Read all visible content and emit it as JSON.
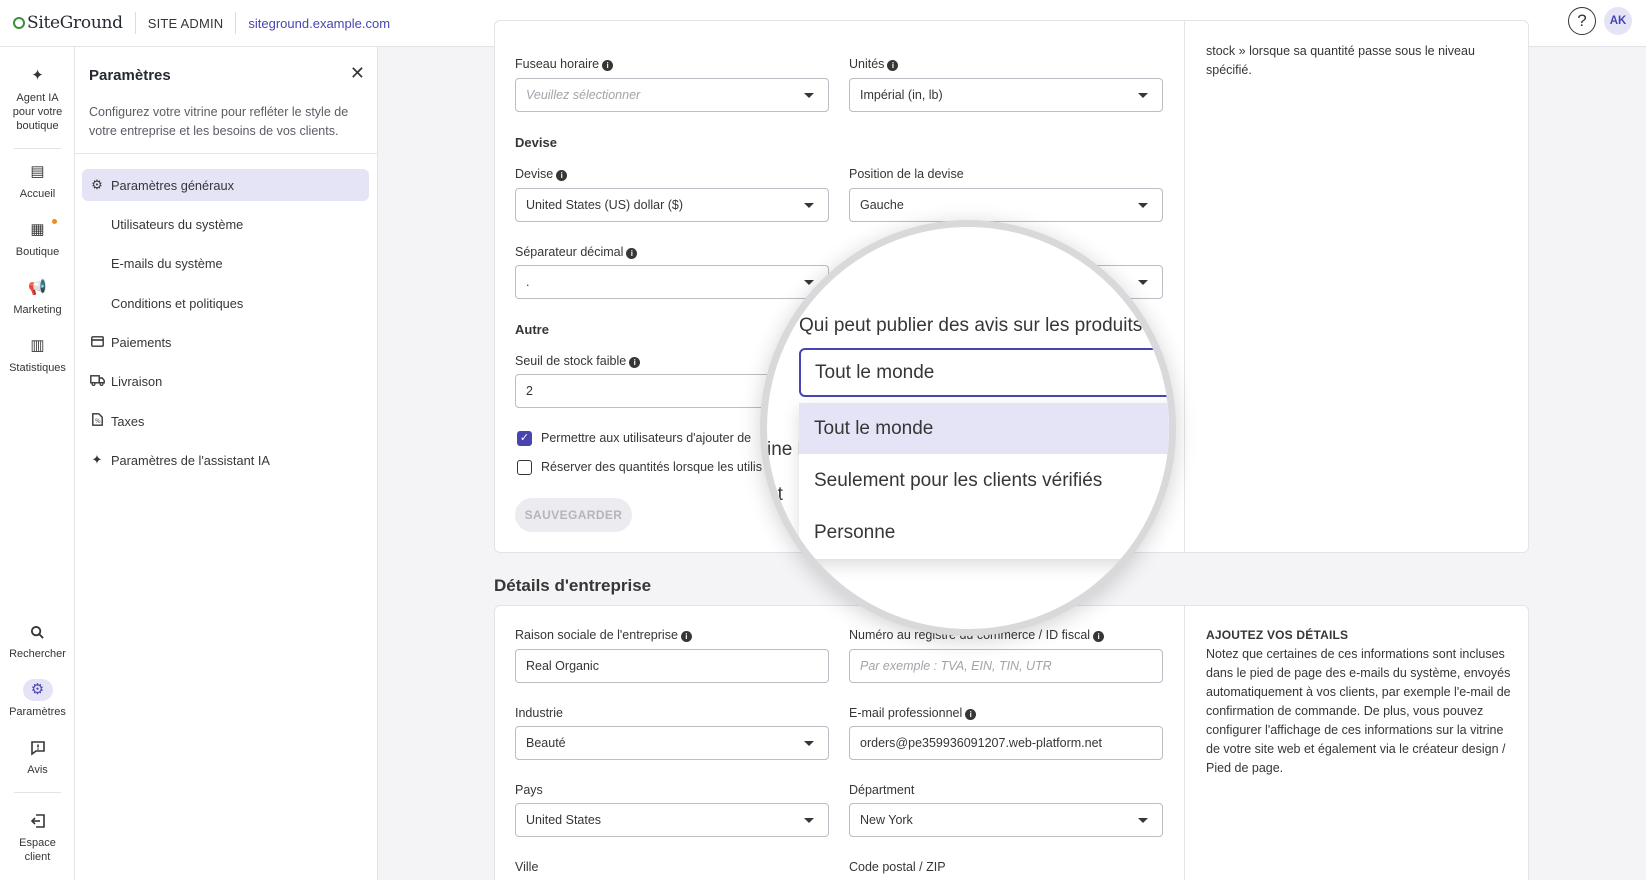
{
  "topbar": {
    "logo_text": "SiteGround",
    "site_admin": "SITE ADMIN",
    "domain": "siteground.example.com",
    "help_glyph": "?",
    "avatar_initials": "AK"
  },
  "rail": {
    "items": [
      {
        "label": "Agent IA pour votre boutique",
        "icon": "sparkle-icon"
      },
      {
        "label": "Accueil",
        "icon": "dashboard-icon"
      },
      {
        "label": "Boutique",
        "icon": "store-icon"
      },
      {
        "label": "Marketing",
        "icon": "megaphone-icon"
      },
      {
        "label": "Statistiques",
        "icon": "chart-icon"
      },
      {
        "label": "Rechercher",
        "icon": "search-icon"
      },
      {
        "label": "Paramètres",
        "icon": "gear-icon"
      },
      {
        "label": "Avis",
        "icon": "review-icon"
      },
      {
        "label": "Espace client",
        "icon": "exit-icon"
      }
    ]
  },
  "panel": {
    "title": "Paramètres",
    "description": "Configurez votre vitrine pour refléter le style de votre entreprise et les besoins de vos clients.",
    "nav": [
      {
        "label": "Paramètres généraux"
      },
      {
        "label": "Utilisateurs du système"
      },
      {
        "label": "E-mails du système"
      },
      {
        "label": "Conditions et politiques"
      },
      {
        "label": "Paiements"
      },
      {
        "label": "Livraison"
      },
      {
        "label": "Taxes"
      },
      {
        "label": "Paramètres de l'assistant IA"
      }
    ]
  },
  "general": {
    "timezone_label": "Fuseau horaire",
    "timezone_placeholder": "Veuillez sélectionner",
    "units_label": "Unités",
    "units_value": "Impérial (in, lb)",
    "currency_section": "Devise",
    "currency_label": "Devise",
    "currency_value": "United States (US) dollar ($)",
    "currency_position_label": "Position de la devise",
    "currency_position_value": "Gauche",
    "decimal_label": "Séparateur décimal",
    "decimal_value": ".",
    "other_section": "Autre",
    "low_stock_label": "Seuil de stock faible",
    "low_stock_value": "2",
    "checkbox_reviews": "Permettre aux utilisateurs d'ajouter de",
    "checkbox_reserve": "Réserver des quantités lorsque les utilis",
    "save_label": "SAUVEGARDER",
    "help_text_top": "stock » lorsque sa quantité passe sous le niveau spécifié."
  },
  "magnifier": {
    "label": "Qui peut publier des avis sur les produits",
    "selected": "Tout le monde",
    "options": [
      "Tout le monde",
      "Seulement pour les clients vérifiés",
      "Personne"
    ],
    "bg_text_1": "ine l",
    "bg_text_2": "nt"
  },
  "business": {
    "heading": "Détails d'entreprise",
    "company_label": "Raison sociale de l'entreprise",
    "company_value": "Real Organic",
    "registry_label": "Numéro au registre du commerce / ID fiscal",
    "registry_placeholder": "Par exemple : TVA, EIN, TIN, UTR",
    "industry_label": "Industrie",
    "industry_value": "Beauté",
    "email_label": "E-mail professionnel",
    "email_value": "orders@pe359936091207.web-platform.net",
    "country_label": "Pays",
    "country_value": "United States",
    "state_label": "Départment",
    "state_value": "New York",
    "city_label": "Ville",
    "zip_label": "Code postal / ZIP",
    "help_heading": "AJOUTEZ VOS DÉTAILS",
    "help_text": "Notez que certaines de ces informations sont incluses dans le pied de page des e-mails du système, envoyés automatiquement à vos clients, par exemple l'e-mail de confirmation de commande. De plus, vous pouvez configurer l'affichage de ces informations sur la vitrine de votre site web et également via le créateur design / Pied de page."
  }
}
